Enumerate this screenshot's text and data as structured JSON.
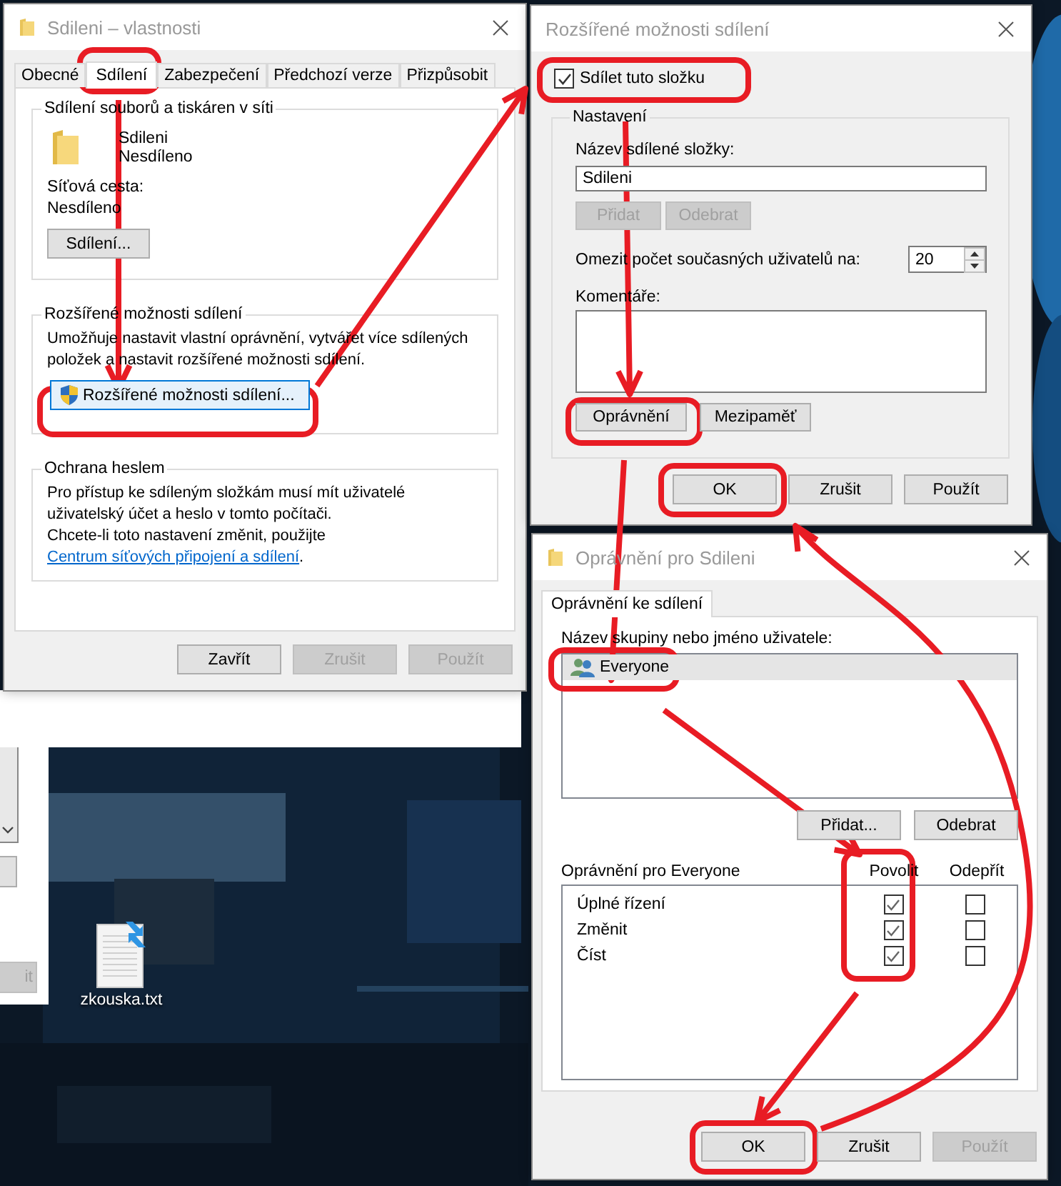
{
  "desktop": {
    "icons": [
      {
        "label": "zkouska.txt"
      }
    ]
  },
  "background_window": {
    "button": "it"
  },
  "properties_dialog": {
    "title": "Sdileni – vlastnosti",
    "tabs": [
      {
        "label": "Obecné",
        "selected": false
      },
      {
        "label": "Sdílení",
        "selected": true
      },
      {
        "label": "Zabezpečení",
        "selected": false
      },
      {
        "label": "Předchozí verze",
        "selected": false
      },
      {
        "label": "Přizpůsobit",
        "selected": false
      }
    ],
    "network_sharing": {
      "legend": "Sdílení souborů a tiskáren v síti",
      "folder_name": "Sdileni",
      "folder_status": "Nesdíleno",
      "path_label": "Síťová cesta:",
      "path_value": "Nesdíleno",
      "share_button": "Sdílení..."
    },
    "advanced": {
      "legend": "Rozšířené možnosti sdílení",
      "description": "Umožňuje nastavit vlastní oprávnění, vytvářet více sdílených položek a nastavit rozšířené možnosti sdílení.",
      "button": "Rozšířené možnosti sdílení..."
    },
    "password": {
      "legend": "Ochrana heslem",
      "text": "Pro přístup ke sdíleným složkám musí mít uživatelé uživatelský účet a heslo v tomto počítači.",
      "change_text": "Chcete-li toto nastavení změnit, použijte",
      "link": "Centrum síťových připojení a sdílení",
      "after_link": "."
    },
    "buttons": [
      {
        "label": "Zavřít",
        "disabled": false
      },
      {
        "label": "Zrušit",
        "disabled": true
      },
      {
        "label": "Použít",
        "disabled": true
      }
    ]
  },
  "advanced_dialog": {
    "title": "Rozšířené možnosti sdílení",
    "share_checkbox": {
      "label": "Sdílet tuto složku",
      "checked": true
    },
    "settings": {
      "legend": "Nastavení",
      "name_label": "Název sdílené složky:",
      "name_value": "Sdileni",
      "name_buttons": [
        {
          "label": "Přidat",
          "disabled": true
        },
        {
          "label": "Odebrat",
          "disabled": true
        }
      ],
      "limit_label": "Omezit počet současných uživatelů na:",
      "limit_value": "20",
      "comments_label": "Komentáře:",
      "action_buttons": [
        {
          "label": "Oprávnění"
        },
        {
          "label": "Mezipaměť"
        }
      ]
    },
    "buttons": [
      {
        "label": "OK",
        "disabled": false
      },
      {
        "label": "Zrušit",
        "disabled": false
      },
      {
        "label": "Použít",
        "disabled": false
      }
    ]
  },
  "permissions_dialog": {
    "title": "Oprávnění pro Sdileni",
    "tabs": [
      {
        "label": "Oprávnění ke sdílení",
        "selected": true
      }
    ],
    "users_label": "Název skupiny nebo jméno uživatele:",
    "users": [
      {
        "name": "Everyone",
        "selected": true
      }
    ],
    "user_buttons": [
      {
        "label": "Přidat...",
        "disabled": false
      },
      {
        "label": "Odebrat",
        "disabled": false
      }
    ],
    "permissions_label": "Oprávnění pro Everyone",
    "allow_header": "Povolit",
    "deny_header": "Odepřít",
    "permissions": [
      {
        "name": "Úplné řízení",
        "allow": true,
        "deny": false
      },
      {
        "name": "Změnit",
        "allow": true,
        "deny": false
      },
      {
        "name": "Číst",
        "allow": true,
        "deny": false
      }
    ],
    "buttons": [
      {
        "label": "OK",
        "disabled": false
      },
      {
        "label": "Zrušit",
        "disabled": false
      },
      {
        "label": "Použít",
        "disabled": true
      }
    ]
  }
}
